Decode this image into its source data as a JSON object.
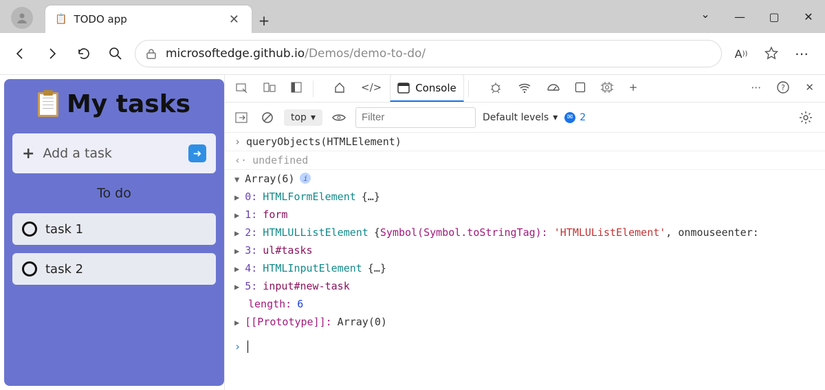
{
  "window": {
    "tab_title": "TODO app",
    "minimize": "—",
    "maximize": "▢",
    "close": "✕"
  },
  "addr": {
    "host": "microsoftedge.github.io",
    "path": "/Demos/demo-to-do/"
  },
  "app": {
    "title": "My tasks",
    "add_placeholder": "Add a task",
    "section": "To do",
    "tasks": [
      "task 1",
      "task 2"
    ]
  },
  "devtools": {
    "console_tab": "Console",
    "context": "top",
    "filter_placeholder": "Filter",
    "levels": "Default levels",
    "msg_count": "2"
  },
  "console": {
    "input": "queryObjects(HTMLElement)",
    "output": "undefined",
    "array_label": "Array(6)",
    "rows": {
      "r0": {
        "idx": "0:",
        "type": "HTMLFormElement",
        "suffix": "{…}"
      },
      "r1": {
        "idx": "1:",
        "sel": "form"
      },
      "r2": {
        "idx": "2:",
        "type": "HTMLULListElement",
        "key": "Symbol(Symbol.toStringTag):",
        "val": "'HTMLUListElement'",
        "tail": ", onmouseenter:"
      },
      "r3": {
        "idx": "3:",
        "sel": "ul#tasks"
      },
      "r4": {
        "idx": "4:",
        "type": "HTMLInputElement",
        "suffix": "{…}"
      },
      "r5": {
        "idx": "5:",
        "sel": "input#new-task"
      },
      "len": {
        "label": "length:",
        "val": "6"
      },
      "proto": {
        "label": "[[Prototype]]:",
        "val": "Array(0)"
      }
    }
  }
}
